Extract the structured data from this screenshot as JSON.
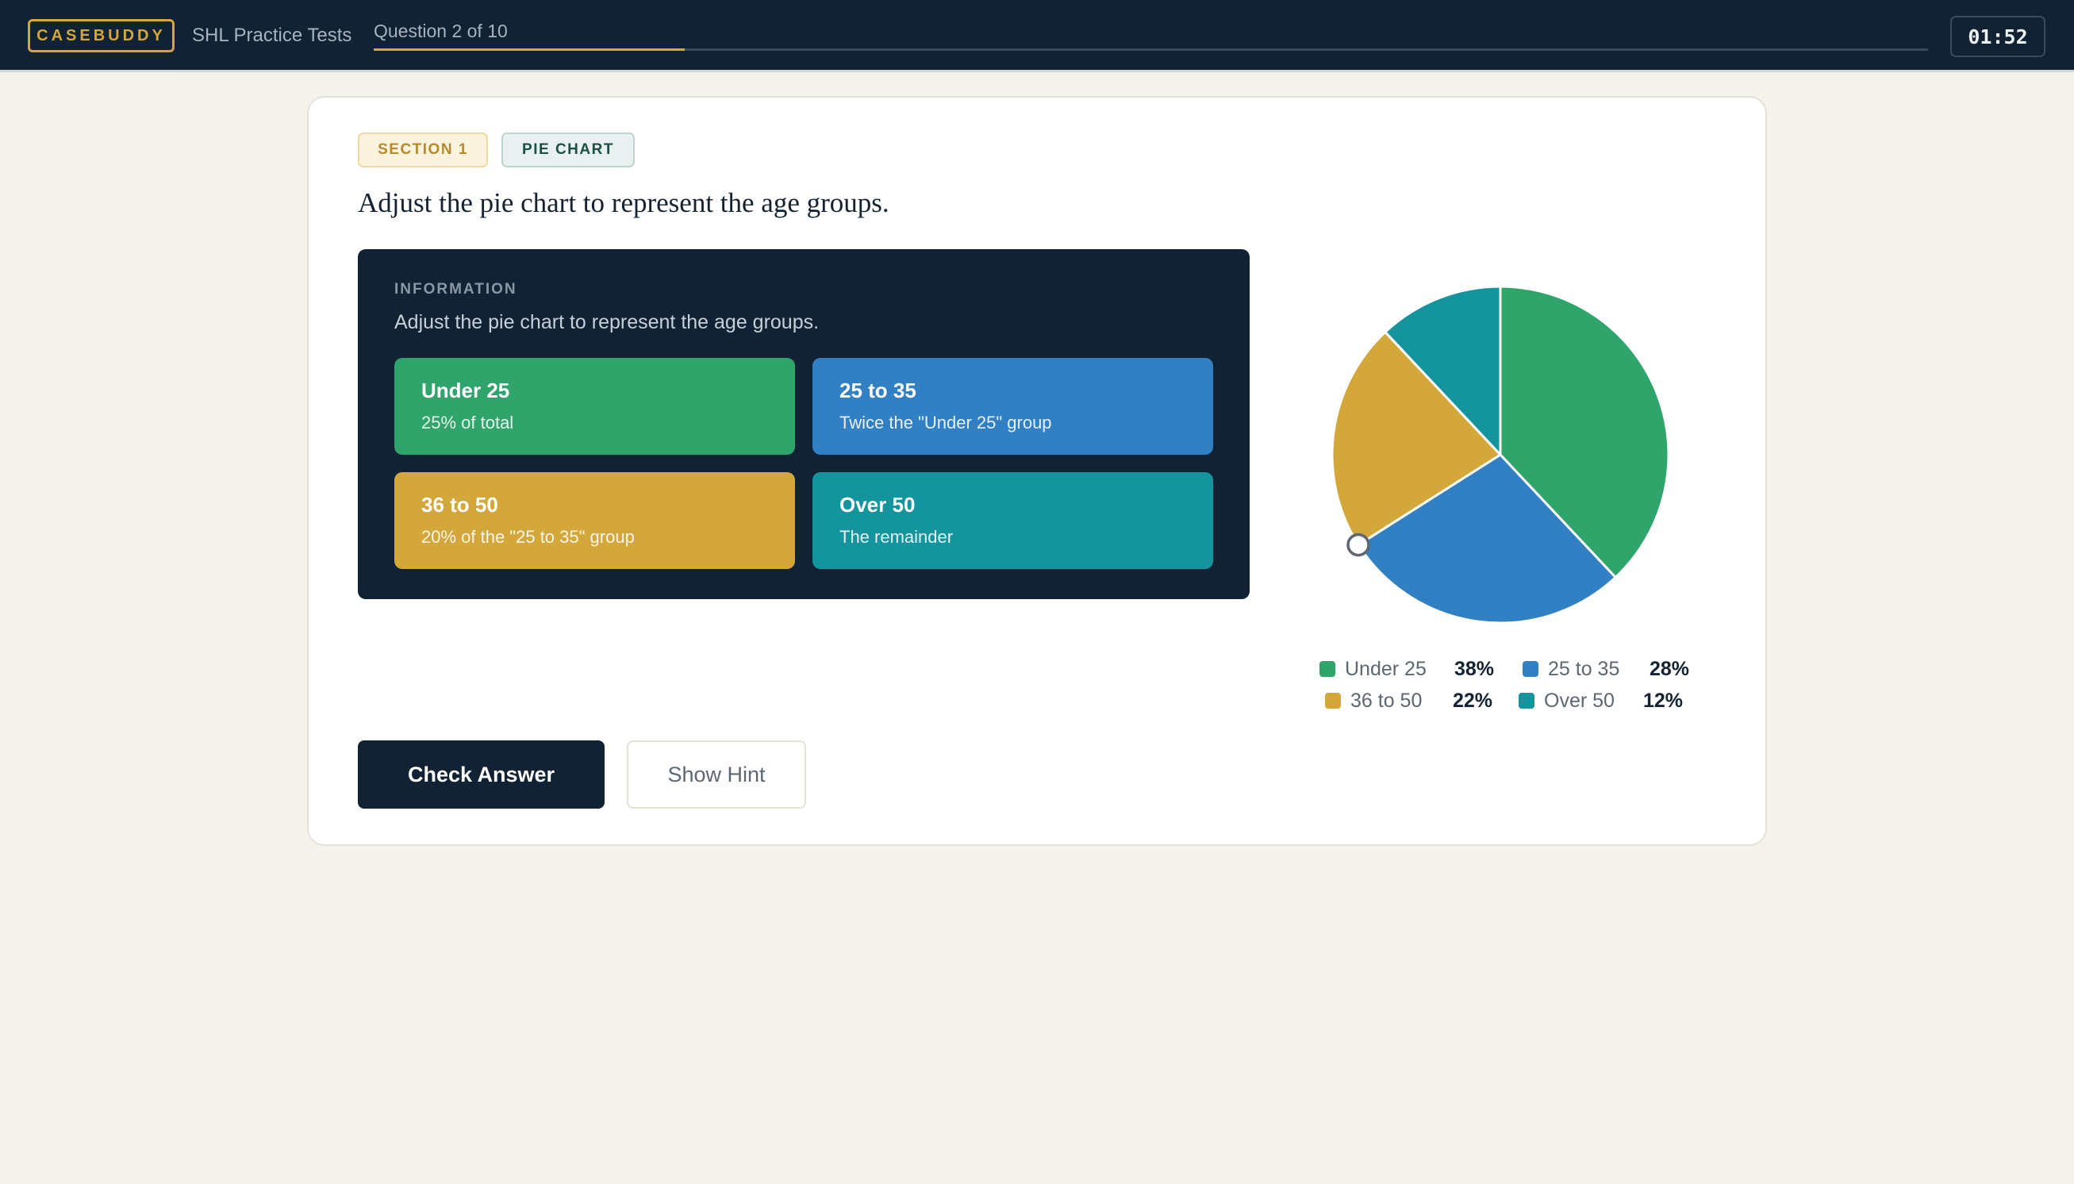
{
  "header": {
    "brand": "CASEBUDDY",
    "app_name": "SHL Practice Tests",
    "progress_label": "Question 2 of 10",
    "progress_fraction": 0.2,
    "timer": "01:52"
  },
  "badges": {
    "section": "SECTION 1",
    "type": "PIE CHART"
  },
  "question": "Adjust the pie chart to represent the age groups.",
  "info": {
    "title": "INFORMATION",
    "text": "Adjust the pie chart to represent the age groups.",
    "rules": [
      {
        "name": "Under 25",
        "desc": "25% of total",
        "color": "#2fa56b"
      },
      {
        "name": "25 to 35",
        "desc": "Twice the \"Under 25\" group",
        "color": "#3280c4"
      },
      {
        "name": "36 to 50",
        "desc": "20% of the \"25 to 35\" group",
        "color": "#d4a73a"
      },
      {
        "name": "Over 50",
        "desc": "The remainder",
        "color": "#14959e"
      }
    ]
  },
  "chart_data": {
    "type": "pie",
    "categories": [
      "Under 25",
      "25 to 35",
      "36 to 50",
      "Over 50"
    ],
    "values": [
      38,
      28,
      22,
      12
    ],
    "labels": [
      "38%",
      "28%",
      "22%",
      "12%"
    ],
    "colors": [
      "#2fa56b",
      "#3280c4",
      "#d4a73a",
      "#14959e"
    ],
    "legend_position": "bottom"
  },
  "buttons": {
    "check": "Check Answer",
    "hint": "Show Hint"
  }
}
